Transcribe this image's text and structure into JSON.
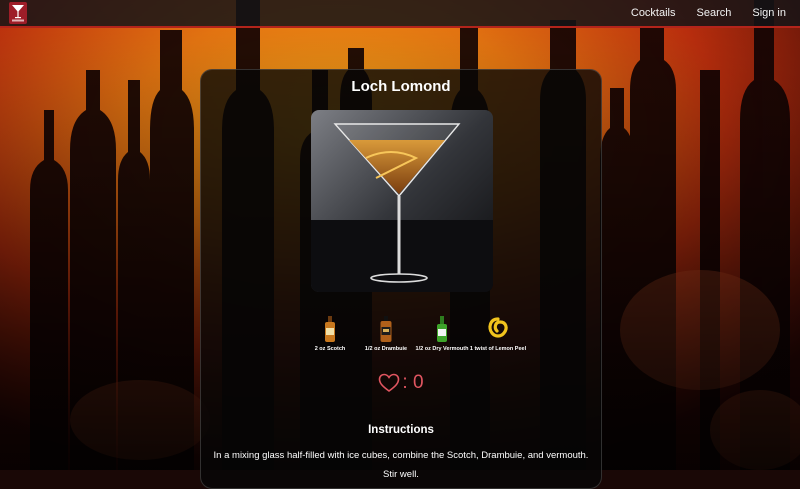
{
  "nav": {
    "links": [
      "Cocktails",
      "Search",
      "Sign in"
    ]
  },
  "cocktail": {
    "name": "Loch Lomond",
    "ingredients": [
      {
        "label": "2 oz Scotch",
        "icon": "scotch-bottle-icon"
      },
      {
        "label": "1/2 oz Drambuie",
        "icon": "drambuie-bottle-icon"
      },
      {
        "label": "1/2 oz Dry Vermouth",
        "icon": "vermouth-bottle-icon"
      },
      {
        "label": "1 twist of Lemon Peel",
        "icon": "lemon-peel-icon"
      }
    ],
    "likes": "0",
    "instructions_heading": "Instructions",
    "instructions": [
      "In a mixing glass half-filled with ice cubes, combine the Scotch, Drambuie, and vermouth.",
      "Stir well."
    ]
  },
  "colors": {
    "accent": "#b3241b",
    "heart": "#e05560",
    "card_bg": "#060606"
  }
}
